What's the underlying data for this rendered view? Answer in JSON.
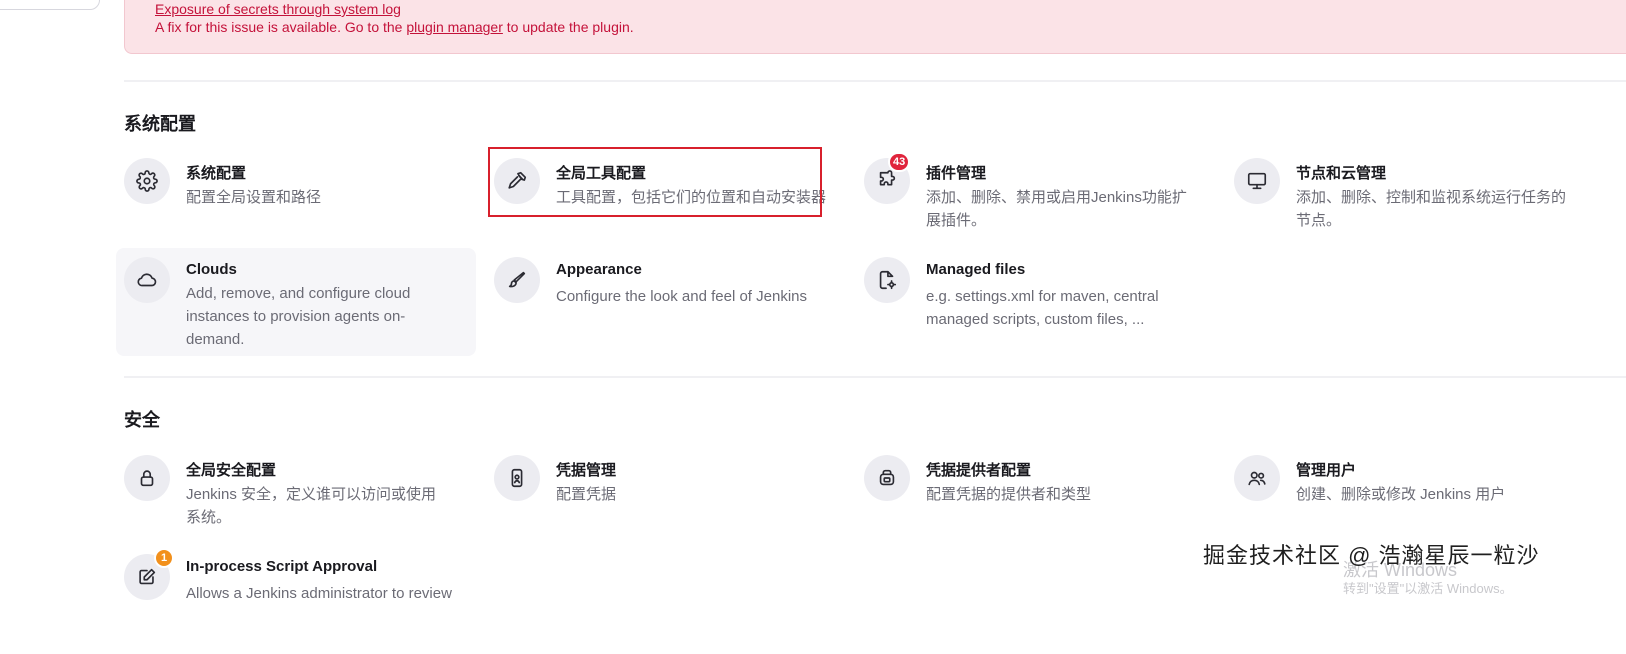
{
  "alert": {
    "secret_link": "Exposure of secrets through system log",
    "fix_prefix": "A fix for this issue is available. Go to the",
    "plugin_manager_link": "plugin manager",
    "fix_suffix": "to update the plugin."
  },
  "sections": {
    "system": {
      "title": "系统配置",
      "items": [
        {
          "title": "系统配置",
          "desc": "配置全局设置和路径",
          "icon": "gear-icon"
        },
        {
          "title": "全局工具配置",
          "desc": "工具配置，包括它们的位置和自动安装器",
          "icon": "hammer-icon"
        },
        {
          "title": "插件管理",
          "desc": "添加、删除、禁用或启用Jenkins功能扩展插件。",
          "icon": "puzzle-icon",
          "badge": "43"
        },
        {
          "title": "节点和云管理",
          "desc": "添加、删除、控制和监视系统运行任务的节点。",
          "icon": "monitor-icon"
        },
        {
          "title": "Clouds",
          "desc": "Add, remove, and configure cloud instances to provision agents on-demand.",
          "icon": "cloud-icon"
        },
        {
          "title": "Appearance",
          "desc": "Configure the look and feel of Jenkins",
          "icon": "brush-icon"
        },
        {
          "title": "Managed files",
          "desc": "e.g. settings.xml for maven, central managed scripts, custom files, ...",
          "icon": "file-gear-icon"
        }
      ]
    },
    "security": {
      "title": "安全",
      "items": [
        {
          "title": "全局安全配置",
          "desc": "Jenkins 安全，定义谁可以访问或使用系统。",
          "icon": "lock-icon"
        },
        {
          "title": "凭据管理",
          "desc": "配置凭据",
          "icon": "id-card-icon"
        },
        {
          "title": "凭据提供者配置",
          "desc": "配置凭据的提供者和类型",
          "icon": "credential-provider-icon"
        },
        {
          "title": "管理用户",
          "desc": "创建、删除或修改 Jenkins 用户",
          "icon": "users-icon"
        },
        {
          "title": "In-process Script Approval",
          "desc": "Allows a Jenkins administrator to review",
          "icon": "edit-icon",
          "badge": "1"
        }
      ]
    }
  },
  "watermark": {
    "text": "掘金技术社区 @ 浩瀚星辰一粒沙",
    "activate": "激活 Windows",
    "activate_sub": "转到\"设置\"以激活 Windows。"
  }
}
